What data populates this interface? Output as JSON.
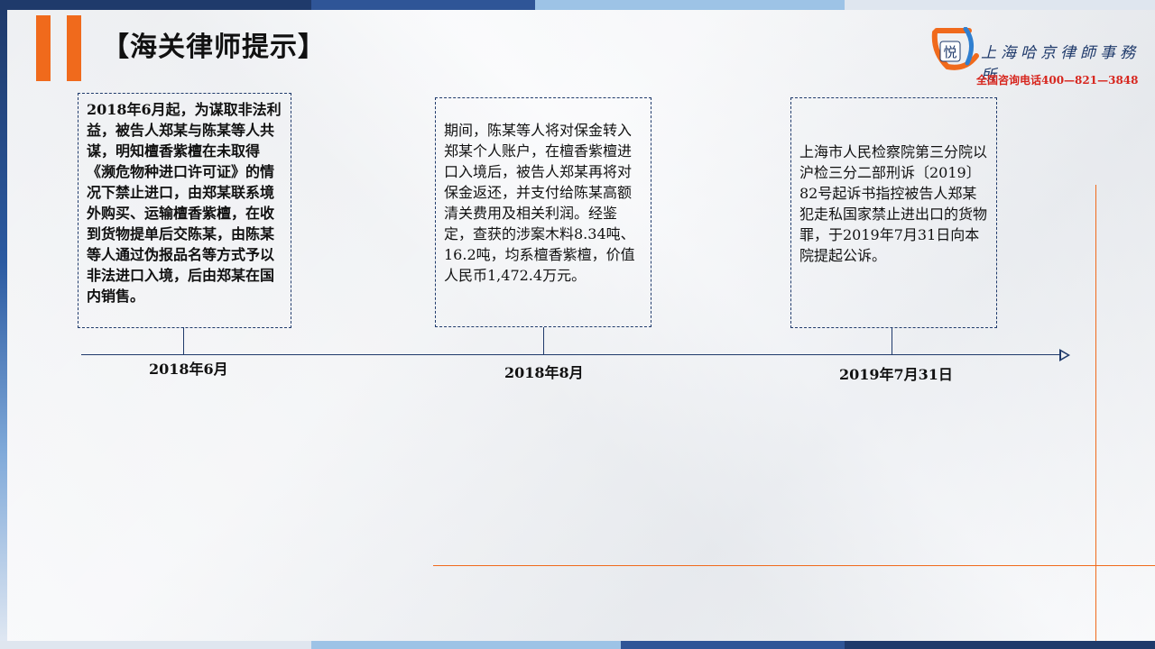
{
  "header": {
    "title": "【海关律师提示】"
  },
  "branding": {
    "firm_name": "上海哈京律師事務所",
    "hotline": "全国咨询电话400—821—3848",
    "logo_icon": "lawfirm-logo-icon",
    "accent_color": "#f06a1c",
    "primary_color": "#1f3a6b"
  },
  "timeline": {
    "events": [
      {
        "date": "2018年6月",
        "text": "2018年6月起，为谋取非法利益，被告人郑某与陈某等人共谋，明知檀香紫檀在未取得《濒危物种进口许可证》的情况下禁止进口，由郑某联系境外购买、运输檀香紫檀，在收到货物提单后交陈某，由陈某等人通过伪报品名等方式予以非法进口入境，后由郑某在国内销售。"
      },
      {
        "date": "2018年8月",
        "text": "期间，陈某等人将对保金转入郑某个人账户，在檀香紫檀进口入境后，被告人郑某再将对保金返还，并支付给陈某高额清关费用及相关利润。经鉴定，查获的涉案木料8.34吨、16.2吨，均系檀香紫檀，价值人民币1,472.4万元。"
      },
      {
        "date": "2019年7月31日",
        "text": "上海市人民检察院第三分院以沪检三分二部刑诉〔2019〕82号起诉书指控被告人郑某犯走私国家禁止进出口的货物罪，于2019年7月31日向本院提起公诉。"
      }
    ]
  }
}
